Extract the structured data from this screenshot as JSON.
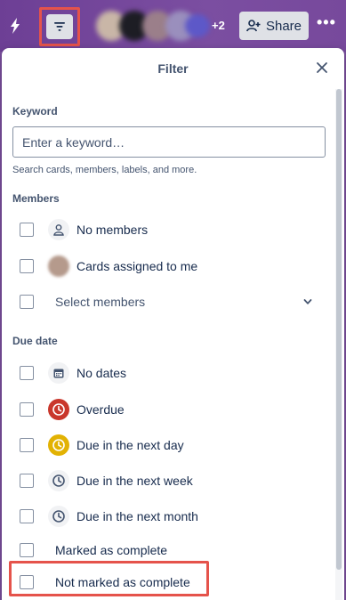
{
  "topbar": {
    "power_up_icon": "lightning-icon",
    "filter_icon": "filter-icon",
    "avatars_extra": "+2",
    "share_label": "Share",
    "share_icon": "add-person-icon",
    "more_icon": "ellipsis-icon",
    "more_label": "•••"
  },
  "filter": {
    "title": "Filter",
    "close_icon": "close-icon",
    "keyword": {
      "label": "Keyword",
      "placeholder": "Enter a keyword…",
      "value": "",
      "helper": "Search cards, members, labels, and more."
    },
    "members": {
      "label": "Members",
      "items": [
        {
          "label": "No members",
          "icon": "person-icon",
          "checked": false
        },
        {
          "label": "Cards assigned to me",
          "icon": "user-avatar",
          "checked": false
        },
        {
          "label": "Select members",
          "icon": "chevron-down-icon",
          "checked": false
        }
      ]
    },
    "due_date": {
      "label": "Due date",
      "items": [
        {
          "label": "No dates",
          "icon": "calendar-icon",
          "color": "#dfe1e6",
          "checked": false
        },
        {
          "label": "Overdue",
          "icon": "clock-icon",
          "color": "#c9372c",
          "checked": false
        },
        {
          "label": "Due in the next day",
          "icon": "clock-icon",
          "color": "#e2b203",
          "checked": false
        },
        {
          "label": "Due in the next week",
          "icon": "clock-icon",
          "color": "#dfe1e6",
          "checked": false
        },
        {
          "label": "Due in the next month",
          "icon": "clock-icon",
          "color": "#dfe1e6",
          "checked": false
        },
        {
          "label": "Marked as complete",
          "checked": false
        },
        {
          "label": "Not marked as complete",
          "checked": false
        }
      ]
    }
  },
  "colors": {
    "board_purple": "#7a4f9e",
    "highlight_red": "#e5534b",
    "overdue_red": "#c9372c",
    "due_soon_yellow": "#e2b203"
  }
}
